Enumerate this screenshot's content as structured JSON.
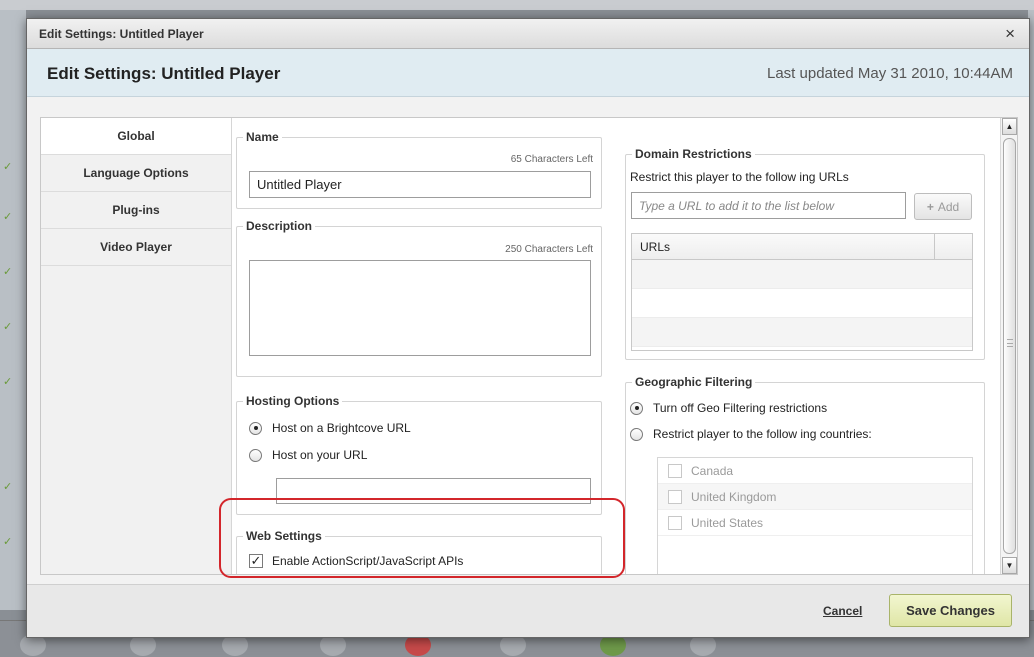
{
  "window": {
    "title": "Edit Settings: Untitled Player",
    "close_symbol": "×"
  },
  "header": {
    "title": "Edit Settings: Untitled Player",
    "last_updated": "Last updated May 31 2010, 10:44AM"
  },
  "tabs": [
    {
      "label": "Global",
      "active": true
    },
    {
      "label": "Language Options",
      "active": false
    },
    {
      "label": "Plug-ins",
      "active": false
    },
    {
      "label": "Video Player",
      "active": false
    }
  ],
  "name_section": {
    "legend": "Name",
    "counter": "65 Characters Left",
    "value": "Untitled Player"
  },
  "description_section": {
    "legend": "Description",
    "counter": "250 Characters Left",
    "value": ""
  },
  "hosting_section": {
    "legend": "Hosting Options",
    "option_brightcove": "Host on a Brightcove URL",
    "option_your_url": "Host on your URL",
    "selected": "brightcove",
    "url_value": ""
  },
  "web_settings": {
    "legend": "Web Settings",
    "api_label": "Enable ActionScript/JavaScript APIs",
    "api_checked": true,
    "check_symbol": "✓"
  },
  "domain_restrictions": {
    "legend": "Domain Restrictions",
    "instruction": "Restrict this player to the follow ing URLs",
    "placeholder": "Type a URL to add it to the list below",
    "add_label": "Add",
    "add_icon": "+",
    "column_header": "URLs"
  },
  "geo_filtering": {
    "legend": "Geographic Filtering",
    "option_off": "Turn off Geo Filtering restrictions",
    "option_restrict": "Restrict player to the follow ing countries:",
    "selected": "off",
    "countries": [
      "Canada",
      "United Kingdom",
      "United States"
    ]
  },
  "footer": {
    "cancel_label": "Cancel",
    "save_label": "Save Changes"
  },
  "colors": {
    "header_bg": "#e0ecf2",
    "highlight_outline": "#d3262b",
    "save_button_bg": "#dfe6a6"
  }
}
